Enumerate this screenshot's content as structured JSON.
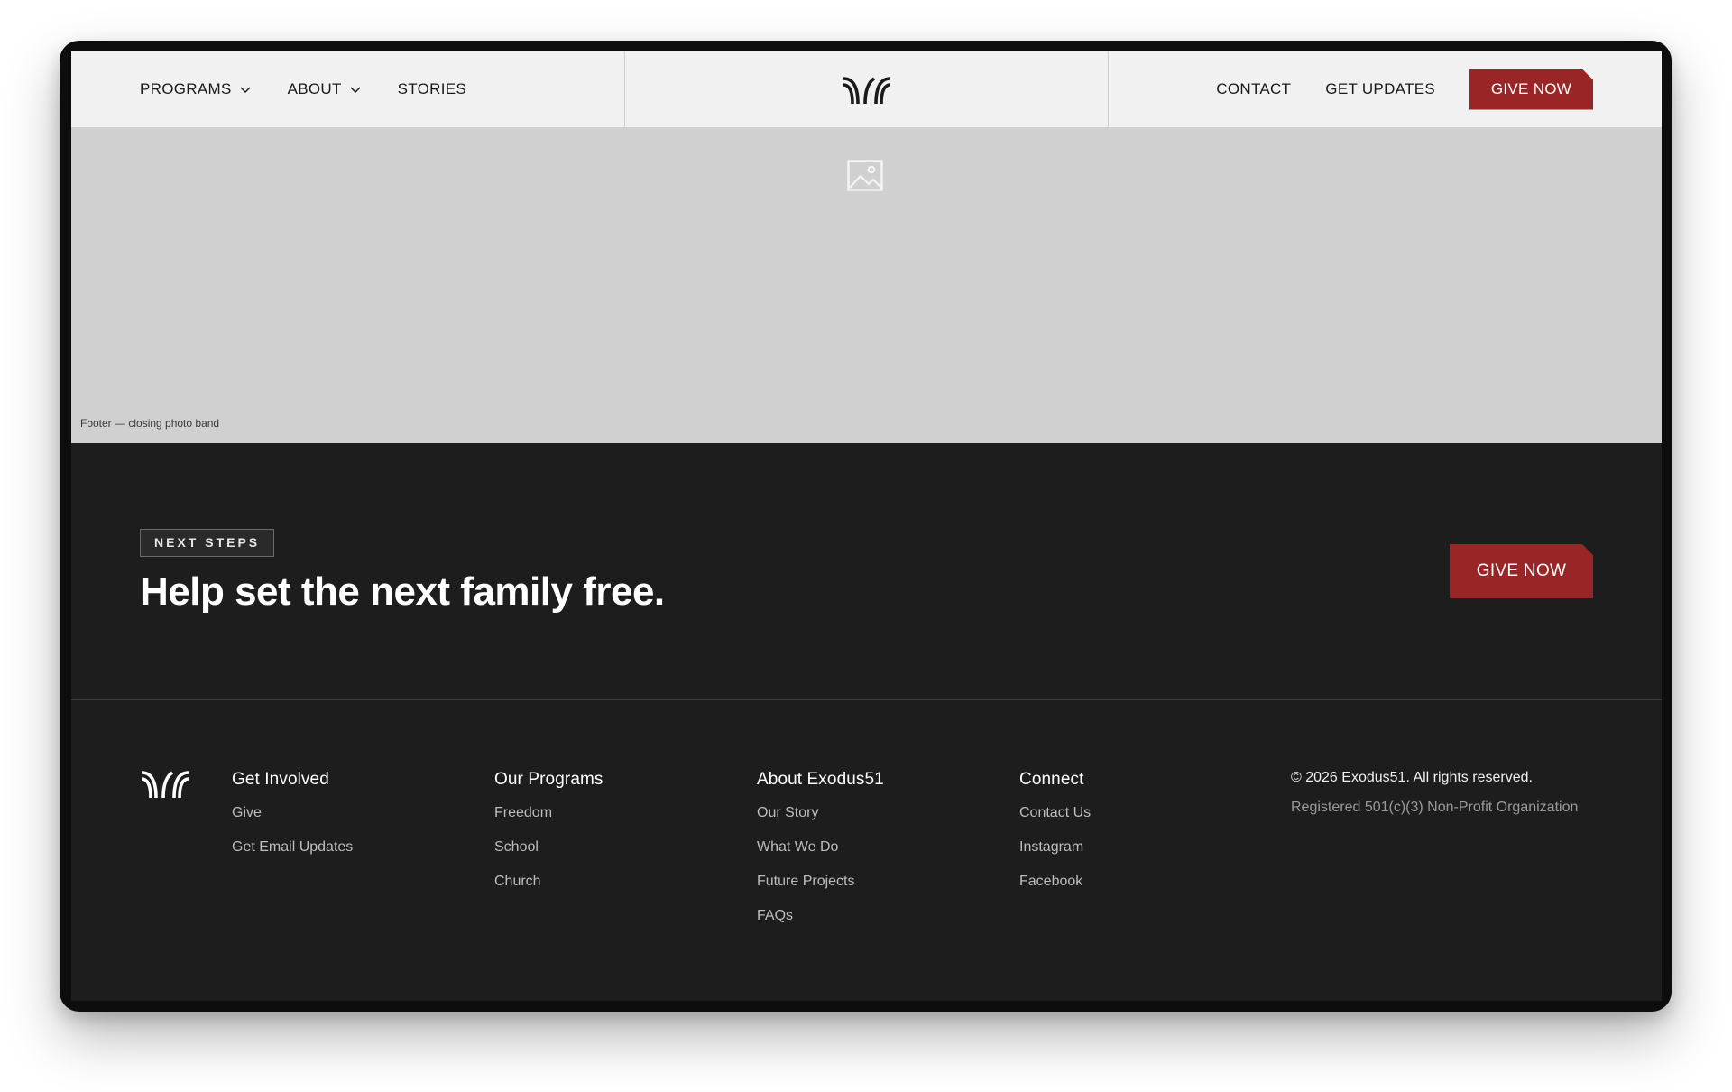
{
  "header": {
    "nav_left": [
      {
        "label": "PROGRAMS",
        "icon": "chevron-down-icon"
      },
      {
        "label": "ABOUT",
        "icon": "chevron-down-icon"
      },
      {
        "label": "STORIES"
      }
    ],
    "nav_right": [
      {
        "label": "CONTACT"
      },
      {
        "label": "GET UPDATES"
      }
    ],
    "give_label": "GIVE NOW",
    "logo_icon": "exodus51-logo-icon"
  },
  "photo_band": {
    "caption": "Footer — closing photo band",
    "icon": "image-placeholder-icon"
  },
  "cta": {
    "eyebrow": "NEXT STEPS",
    "title": "Help set the next family free.",
    "give_label": "GIVE NOW"
  },
  "footer": {
    "columns": [
      {
        "heading": "Get Involved",
        "links": [
          "Give",
          "Get Email Updates"
        ]
      },
      {
        "heading": "Our Programs",
        "links": [
          "Freedom",
          "School",
          "Church"
        ]
      },
      {
        "heading": "About Exodus51",
        "links": [
          "Our Story",
          "What We Do",
          "Future Projects",
          "FAQs"
        ]
      },
      {
        "heading": "Connect",
        "links": [
          "Contact Us",
          "Instagram",
          "Facebook"
        ]
      }
    ],
    "copyright": "© 2026 Exodus51. All rights reserved.",
    "registration": "Registered 501(c)(3) Non-Profit Organization"
  },
  "colors": {
    "accent": "#9a2526",
    "dark_bg": "#1d1d1d",
    "header_bg": "#f1f1f1",
    "photo_bg": "#d0d0d0"
  }
}
